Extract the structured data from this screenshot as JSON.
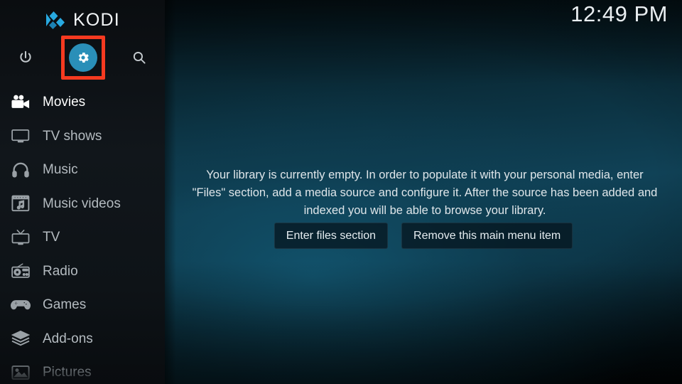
{
  "app": {
    "name": "KODI",
    "logo_icon": "kodi-logo-icon"
  },
  "header": {
    "clock": "12:49 PM",
    "power_icon": "power-icon",
    "settings_icon": "gear-icon",
    "search_icon": "search-icon",
    "focus_highlight_color": "#f63a20",
    "settings_accent_color": "#2a8fb8"
  },
  "sidebar": {
    "items": [
      {
        "label": "Movies",
        "icon": "movie-camera-icon",
        "state": "selected"
      },
      {
        "label": "TV shows",
        "icon": "television-icon",
        "state": "normal"
      },
      {
        "label": "Music",
        "icon": "headphones-icon",
        "state": "normal"
      },
      {
        "label": "Music videos",
        "icon": "film-music-icon",
        "state": "normal"
      },
      {
        "label": "TV",
        "icon": "tv-antenna-icon",
        "state": "normal"
      },
      {
        "label": "Radio",
        "icon": "radio-icon",
        "state": "normal"
      },
      {
        "label": "Games",
        "icon": "gamepad-icon",
        "state": "normal"
      },
      {
        "label": "Add-ons",
        "icon": "open-box-icon",
        "state": "normal"
      },
      {
        "label": "Pictures",
        "icon": "picture-icon",
        "state": "dim"
      }
    ]
  },
  "main": {
    "empty_message": "Your library is currently empty. In order to populate it with your personal media, enter \"Files\" section, add a media source and configure it. After the source has been added and indexed you will be able to browse your library.",
    "buttons": [
      {
        "label": "Enter files section",
        "name": "enter-files-section-button"
      },
      {
        "label": "Remove this main menu item",
        "name": "remove-main-menu-item-button"
      }
    ]
  }
}
